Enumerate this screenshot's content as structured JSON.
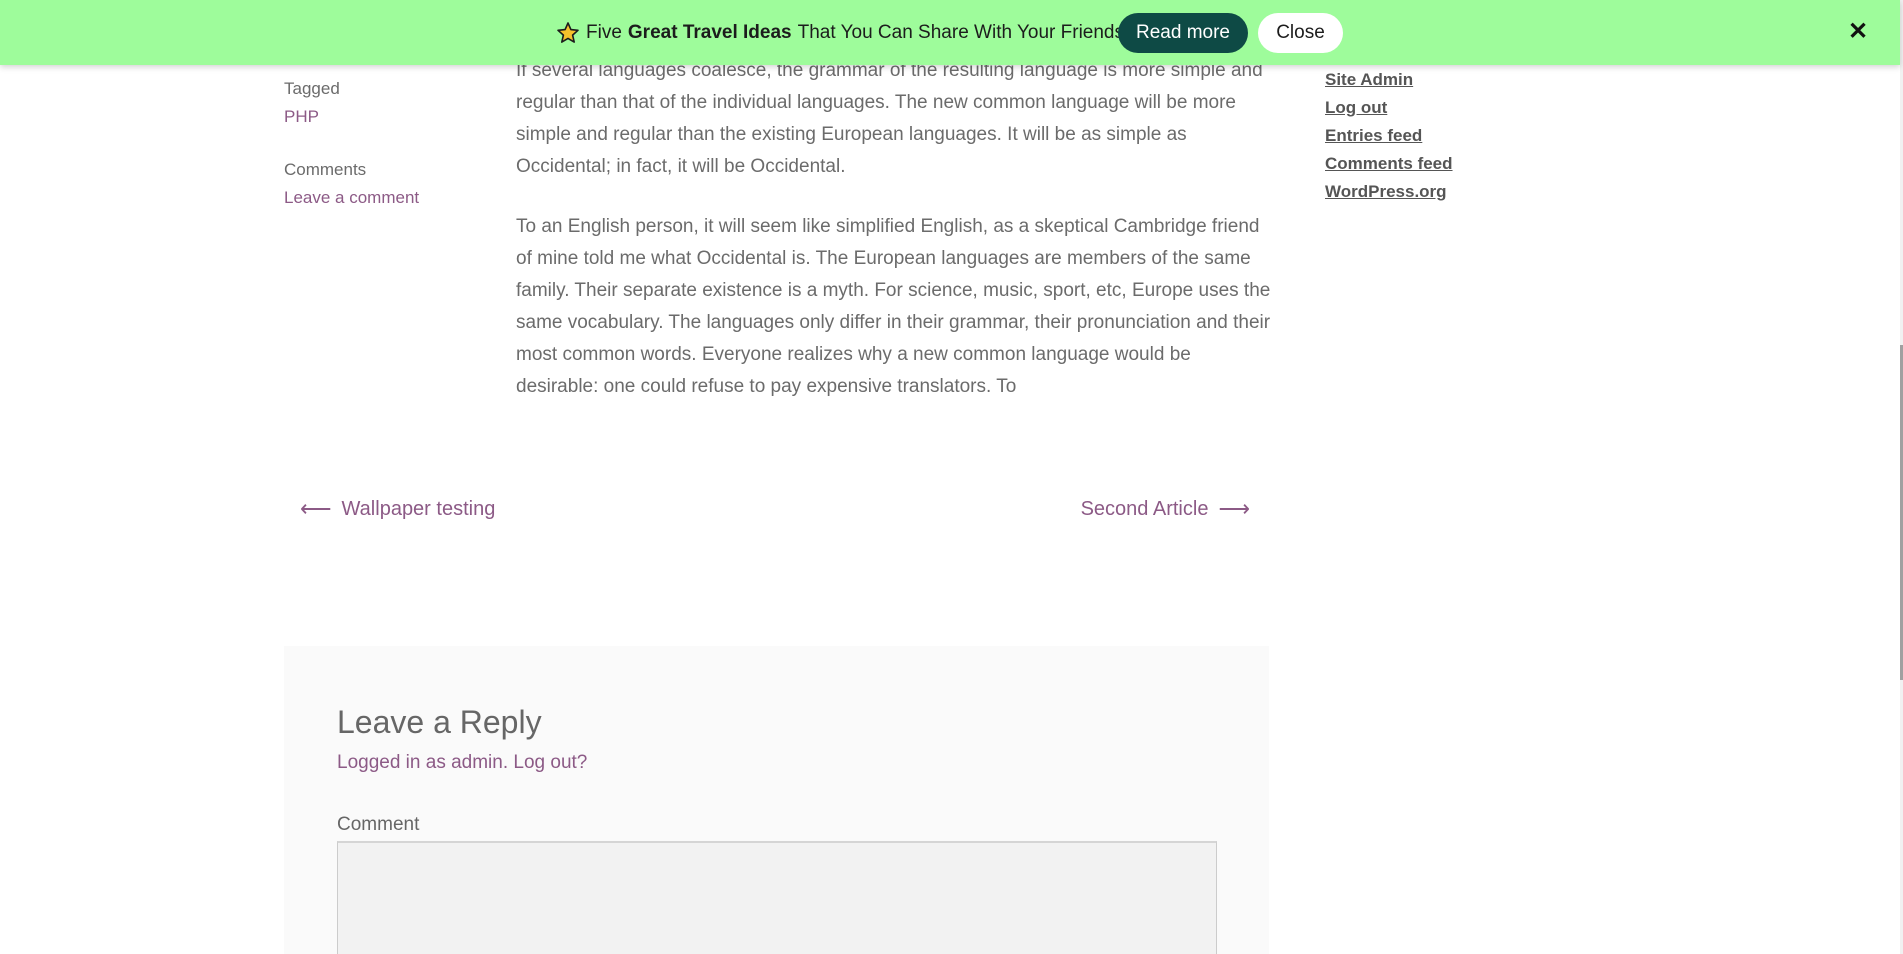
{
  "notice": {
    "star_icon": "star-icon",
    "text_before": "Five",
    "text_bold": "Great Travel Ideas",
    "text_after": "That You Can Share With Your Friends.",
    "read_more_label": "Read more",
    "close_label": "Close",
    "dismiss_icon": "✕",
    "bg_color": "#9efc9b",
    "button_color": "#0e4a45"
  },
  "meta": {
    "tagged_label": "Tagged",
    "tag": "PHP",
    "comments_label": "Comments",
    "leave_comment": "Leave a comment"
  },
  "article": {
    "paragraphs": [
      "If several languages coalesce, the grammar of the resulting language is more simple and regular than that of the individual languages. The new common language will be more simple and regular than the existing European languages. It will be as simple as Occidental; in fact, it will be Occidental.",
      "To an English person, it will seem like simplified English, as a skeptical Cambridge friend of mine told me what Occidental is. The European languages are members of the same family. Their separate existence is a myth. For science, music, sport, etc, Europe uses the same vocabulary. The languages only differ in their grammar, their pronunciation and their most common words. Everyone realizes why a new common language would be desirable: one could refuse to pay expensive translators. To"
    ]
  },
  "sidebar": {
    "links": [
      "Site Admin",
      "Log out",
      "Entries feed",
      "Comments feed",
      "WordPress.org"
    ]
  },
  "post_nav": {
    "prev_label": "Wallpaper testing",
    "next_label": "Second Article",
    "prev_arrow": "⟵",
    "next_arrow": "⟶"
  },
  "reply": {
    "title": "Leave a Reply",
    "logged_in_text": "Logged in as admin.",
    "logout_link": "Log out?",
    "comment_label": "Comment",
    "comment_value": ""
  }
}
